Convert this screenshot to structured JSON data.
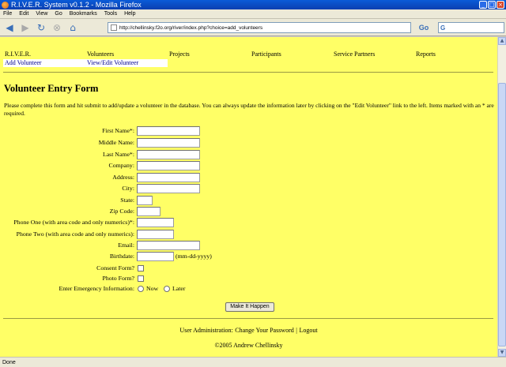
{
  "window": {
    "title": "R.I.V.E.R. System v0.1.2 - Mozilla Firefox",
    "controls": {
      "minimize": "_",
      "maximize": "□",
      "close": "×"
    }
  },
  "menu": [
    "File",
    "Edit",
    "View",
    "Go",
    "Bookmarks",
    "Tools",
    "Help"
  ],
  "toolbar": {
    "url": "http://chellinsky.f2o.org/river/index.php?choice=add_volunteers",
    "go_label": "Go",
    "search_logo": "G"
  },
  "nav": {
    "items": [
      "R.I.V.E.R.",
      "Volunteers",
      "Projects",
      "Participants",
      "Service Partners",
      "Reports"
    ],
    "sub_items": [
      "Add Volunteer",
      "View/Edit Volunteer"
    ]
  },
  "page": {
    "heading": "Volunteer Entry Form",
    "intro": "Please complete this form and hit submit to add/update a volunteer in the database. You can always update the information later by clicking on the \"Edit Volunteer\" link to the left. Items marked with an * are required."
  },
  "form": {
    "first_name": "First Name*:",
    "middle_name": "Middle Name:",
    "last_name": "Last Name*:",
    "company": "Company:",
    "address": "Address:",
    "city": "City:",
    "state": "State:",
    "zip": "Zip Code:",
    "phone_one": "Phone One (with area code and only numerics)*:",
    "phone_two": "Phone Two (with area code and only numerics):",
    "email": "Email:",
    "birthdate": "Birthdate:",
    "birthdate_hint": "(mm-dd-yyyy)",
    "consent": "Consent Form?",
    "photo": "Photo Form?",
    "emergency": "Enter Emergency Information:",
    "emergency_now": "Now",
    "emergency_later": "Later",
    "submit_label": "Make It Happen"
  },
  "footer": {
    "admin_label": "User Administration:",
    "change_password": "Change Your Password",
    "separator": "|",
    "logout": "Logout",
    "copyright": "©2005 Andrew Chellinsky"
  },
  "status": "Done"
}
